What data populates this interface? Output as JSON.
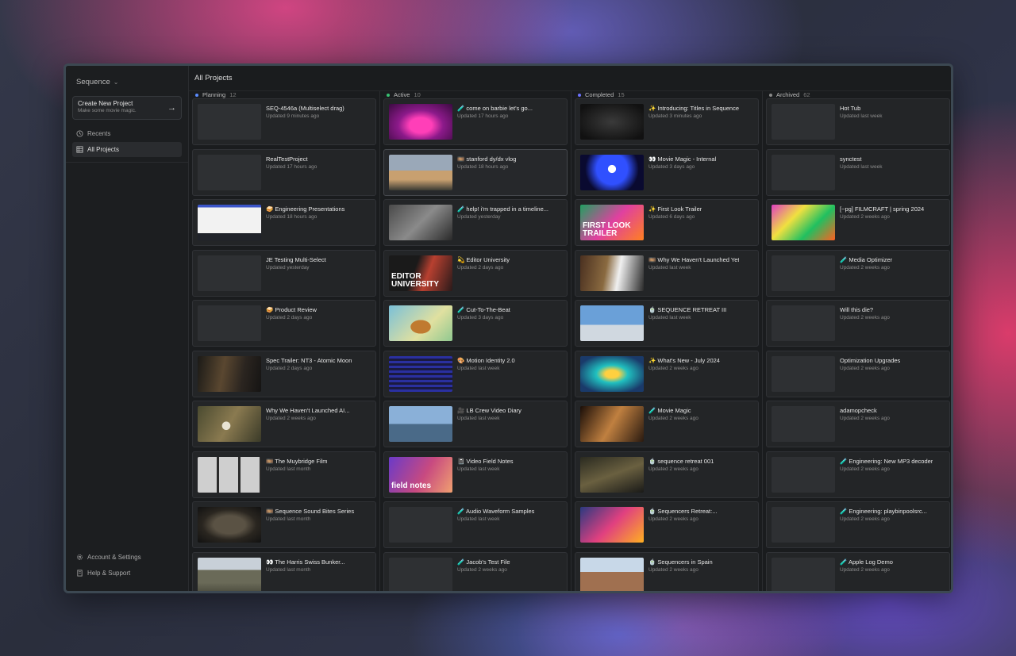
{
  "app": {
    "brand": "Sequence"
  },
  "sidebar": {
    "create": {
      "title": "Create New Project",
      "subtitle": "Make some movie magic."
    },
    "nav": [
      {
        "label": "Recents",
        "icon": "clock-icon",
        "active": false
      },
      {
        "label": "All Projects",
        "icon": "grid-icon",
        "active": true
      }
    ],
    "bottom": [
      {
        "label": "Account & Settings",
        "icon": "gear-icon"
      },
      {
        "label": "Help & Support",
        "icon": "book-icon"
      }
    ]
  },
  "header": {
    "title": "All Projects"
  },
  "columns": [
    {
      "name": "Planning",
      "count": "12",
      "dot": "#5b8cff",
      "cards": [
        {
          "title": "SEQ-4546a (Multiselect drag)",
          "updated": "Updated 9 minutes ago",
          "thumb": ""
        },
        {
          "title": "RealTestProject",
          "updated": "Updated 17 hours ago",
          "thumb": ""
        },
        {
          "title": "🥪 Engineering Presentations",
          "updated": "Updated 18 hours ago",
          "thumb": "linear-gradient(180deg,#3a54c8 0 8%,#f2f2f2 8% 80%,#20232a 80%)"
        },
        {
          "title": "JE Testing Multi-Select",
          "updated": "Updated yesterday",
          "thumb": ""
        },
        {
          "title": "🥪 Product Review",
          "updated": "Updated 2 days ago",
          "thumb": ""
        },
        {
          "title": "Spec Trailer: NT3 - Atomic Moon",
          "updated": "Updated 2 days ago",
          "thumb": "linear-gradient(100deg,#1b1a17,#5a4730 40%,#2b2520 70%,#151413)"
        },
        {
          "title": "Why We Haven't Launched AI...",
          "updated": "Updated 2 weeks ago",
          "thumb": "radial-gradient(circle at 45% 55%,#e9e4d4 0 10%,transparent 11%),linear-gradient(120deg,#4a4a30,#8a7a50 50%,#3a3a28)"
        },
        {
          "title": "🎞️ The Muybridge Film",
          "updated": "Updated last month",
          "thumb": "repeating-linear-gradient(90deg,#cfcfcf 0 24px,#2a2a2a 24px 27px),#2a2a2a"
        },
        {
          "title": "🎞️ Sequence Sound Bites Series",
          "updated": "Updated last month",
          "thumb": "radial-gradient(ellipse at 50% 50%,#5a5244 0 35%,#2a2620 60%,#111 100%)"
        },
        {
          "title": "👀 The Harris Swiss Bunker...",
          "updated": "Updated last month",
          "thumb": "linear-gradient(180deg,#c8d0d8 0 35%,#6a6a58 35% 70%,#4a4a3c)"
        }
      ]
    },
    {
      "name": "Active",
      "count": "10",
      "dot": "#38c172",
      "cards": [
        {
          "title": "🧪 come on barbie let's go...",
          "updated": "Updated 17 hours ago",
          "thumb": "radial-gradient(ellipse at 50% 60%,#ff3fb8 0 25%,#8c1a8a 50%,#3a0a40 100%)",
          "tt": ""
        },
        {
          "title": "🎞️ stanford dy/dx vlog",
          "updated": "Updated 18 hours ago",
          "thumb": "linear-gradient(180deg,#9aa8b8 0 45%,#c8a070 45% 70%,#3a3a34)",
          "hl": true
        },
        {
          "title": "🧪 help! i'm trapped in a timeline...",
          "updated": "Updated yesterday",
          "thumb": "linear-gradient(135deg,#4a4a4a,#8a8a8a 50%,#2a2a2a)"
        },
        {
          "title": "💫 Editor University",
          "updated": "Updated 2 days ago",
          "thumb": "linear-gradient(110deg,#1a1a1a 0 40%,#b84030 60%,#2a1a1a)",
          "tt": "EDITOR UNIVERSITY"
        },
        {
          "title": "🧪 Cut-To-The-Beat",
          "updated": "Updated 3 days ago",
          "thumb": "radial-gradient(ellipse at 50% 60%,#c07a30 0 22%,transparent 23%),linear-gradient(135deg,#7ac0d8,#e0e0a0 60%,#90c890)"
        },
        {
          "title": "🎨 Motion Identity 2.0",
          "updated": "Updated last week",
          "thumb": "repeating-linear-gradient(0deg,#2a30a0 0 3px,#1a1a40 3px 6px)"
        },
        {
          "title": "🎥 LB Crew Video Diary",
          "updated": "Updated last week",
          "thumb": "linear-gradient(180deg,#8ab0d8 0 50%,#4a6a88 50%)"
        },
        {
          "title": "📓 Video Field Notes",
          "updated": "Updated last week",
          "thumb": "linear-gradient(120deg,#6a3ac8,#c84a80 55%,#f0a070)",
          "tt": "field notes"
        },
        {
          "title": "🧪 Audio Waveform Samples",
          "updated": "Updated last week",
          "thumb": ""
        },
        {
          "title": "🧪 Jacob's Test File",
          "updated": "Updated 2 weeks ago",
          "thumb": ""
        }
      ]
    },
    {
      "name": "Completed",
      "count": "15",
      "dot": "#6c72ff",
      "cards": [
        {
          "title": "✨ Introducing: Titles in Sequence",
          "updated": "Updated 3 minutes ago",
          "thumb": "radial-gradient(ellipse at 50% 50%,#3a3a3a,#111 85%)"
        },
        {
          "title": "👀 Movie Magic - Internal",
          "updated": "Updated 3 days ago",
          "thumb": "radial-gradient(circle at 50% 40%,#ffffff 0 10%,#3050ff 11% 40%,#0a0a30 70%)"
        },
        {
          "title": "✨ First Look Trailer",
          "updated": "Updated 6 days ago",
          "thumb": "linear-gradient(135deg,#20a060,#e040a0 50%,#ff8020)",
          "tt": "FIRST LOOK TRAILER"
        },
        {
          "title": "🎞️ Why We Haven't Launched Yet",
          "updated": "Updated last week",
          "thumb": "linear-gradient(100deg,#4a3020,#8a6a40 40%,#f0f0f0 60%,#2a2a2a)"
        },
        {
          "title": "🍵 SEQUENCE RETREAT III",
          "updated": "Updated last week",
          "thumb": "linear-gradient(180deg,#6aa0d8 0 55%,#d0d8e0 55%)"
        },
        {
          "title": "✨ What's New - July 2024",
          "updated": "Updated 2 weeks ago",
          "thumb": "radial-gradient(ellipse at 50% 50%,#ffd040 0 15%,#20c0c0 35%,#1a3a6a 80%)"
        },
        {
          "title": "🧪 Movie Magic",
          "updated": "Updated 2 weeks ago",
          "thumb": "linear-gradient(120deg,#1a0e08,#c08040 50%,#2a1a10)"
        },
        {
          "title": "🍵 sequence retreat 001",
          "updated": "Updated 2 weeks ago",
          "thumb": "linear-gradient(160deg,#2a2a20,#6a6040 50%,#1a1a18)"
        },
        {
          "title": "🍵 Sequencers Retreat:...",
          "updated": "Updated 2 weeks ago",
          "thumb": "linear-gradient(135deg,#2a3a80,#e04080 50%,#ffb020)"
        },
        {
          "title": "🍵 Sequencers in Spain",
          "updated": "Updated 2 weeks ago",
          "thumb": "linear-gradient(180deg,#c8d8e8 0 40%,#a07050 40%)"
        }
      ]
    },
    {
      "name": "Archived",
      "count": "62",
      "dot": "#8a8a8a",
      "cards": [
        {
          "title": "Hot Tub",
          "updated": "Updated last week",
          "thumb": ""
        },
        {
          "title": "synctest",
          "updated": "Updated last week",
          "thumb": ""
        },
        {
          "title": "[~pg] FILMCRAFT | spring 2024",
          "updated": "Updated 2 weeks ago",
          "thumb": "linear-gradient(135deg,#e040c0,#f0e040 35%,#20c060 65%,#ff6020)"
        },
        {
          "title": "🧪 Media Optimizer",
          "updated": "Updated 2 weeks ago",
          "thumb": ""
        },
        {
          "title": "Will this die?",
          "updated": "Updated 2 weeks ago",
          "thumb": ""
        },
        {
          "title": "Optimization Upgrades",
          "updated": "Updated 2 weeks ago",
          "thumb": ""
        },
        {
          "title": "adamopcheck",
          "updated": "Updated 2 weeks ago",
          "thumb": ""
        },
        {
          "title": "🧪 Engineering: New MP3 decoder",
          "updated": "Updated 2 weeks ago",
          "thumb": ""
        },
        {
          "title": "🧪 Engineering: playbinpoolsrc...",
          "updated": "Updated 2 weeks ago",
          "thumb": ""
        },
        {
          "title": "🧪 Apple Log Demo",
          "updated": "Updated 2 weeks ago",
          "thumb": ""
        }
      ]
    }
  ]
}
